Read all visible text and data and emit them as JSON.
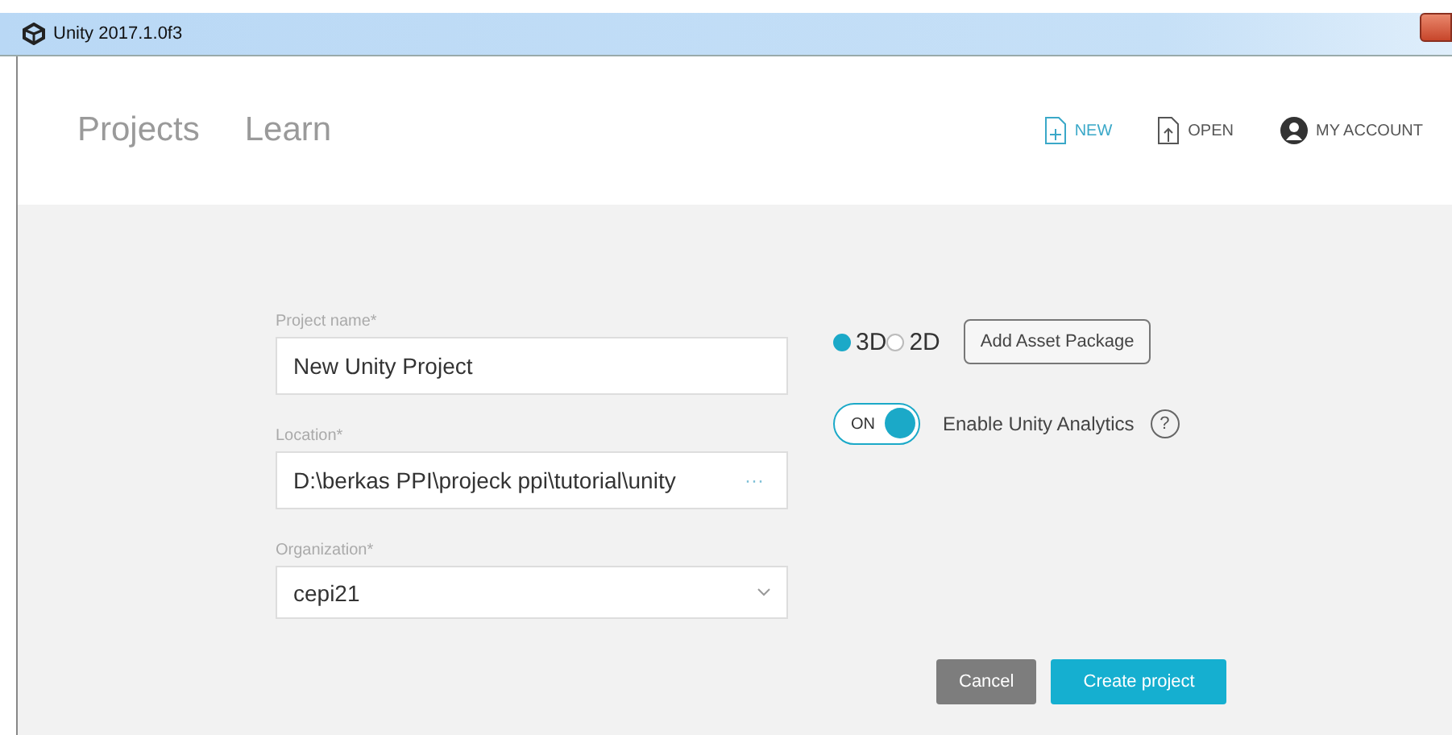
{
  "window": {
    "title": "Unity 2017.1.0f3"
  },
  "nav_tabs": [
    {
      "label": "Projects",
      "selected": false
    },
    {
      "label": "Learn",
      "selected": false
    }
  ],
  "actions": [
    {
      "kind": "new",
      "label": "NEW",
      "selected": true
    },
    {
      "kind": "open",
      "label": "OPEN",
      "selected": false
    },
    {
      "kind": "account",
      "label": "MY ACCOUNT",
      "selected": false
    }
  ],
  "form": {
    "project_name": {
      "label": "Project name*",
      "value": "New Unity Project"
    },
    "location": {
      "label": "Location*",
      "value": "D:\\berkas PPI\\projeck ppi\\tutorial\\unity",
      "browse": "···"
    },
    "organization": {
      "label": "Organization*",
      "value": "cepi21"
    }
  },
  "modes": [
    {
      "label": "3D",
      "selected": true
    },
    {
      "label": "2D",
      "selected": false
    }
  ],
  "add_asset_button": "Add Asset Package",
  "analytics": {
    "toggle_label": "ON",
    "on": true,
    "label": "Enable Unity Analytics",
    "help": "?"
  },
  "buttons": [
    {
      "kind": "secondary",
      "label": "Cancel"
    },
    {
      "kind": "primary",
      "label": "Create project"
    }
  ]
}
